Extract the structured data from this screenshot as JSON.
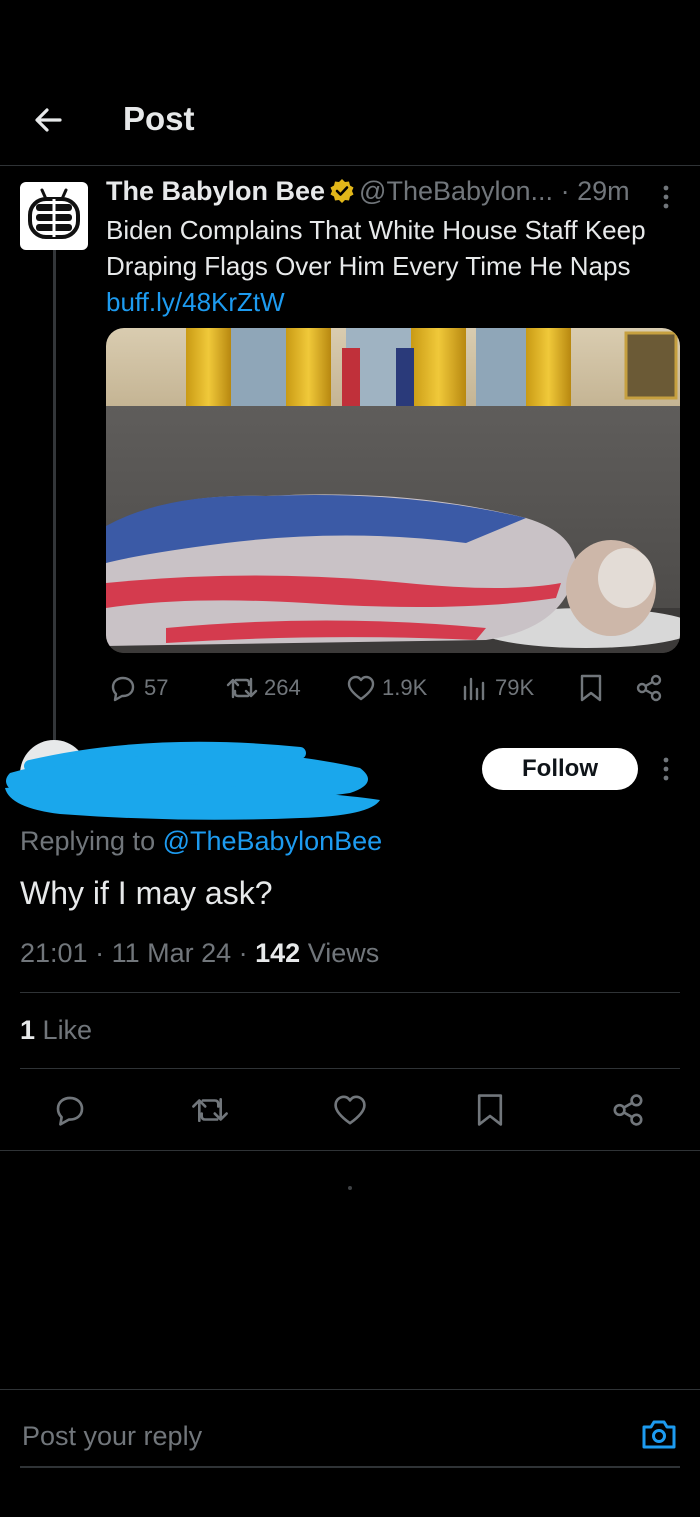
{
  "header": {
    "title": "Post"
  },
  "tweet": {
    "author_name": "The Babylon Bee",
    "handle": "@TheBabylon...",
    "time": "· 29m",
    "text": "Biden Complains That White House Staff Keep Draping Flags Over Him Every Time He Naps ",
    "link": "buff.ly/48KrZtW",
    "stats": {
      "replies": "57",
      "reposts": "264",
      "likes": "1.9K",
      "views": "79K"
    }
  },
  "reply": {
    "follow_label": "Follow",
    "replying_prefix": "Replying to ",
    "replying_to": "@TheBabylonBee",
    "text": "Why if I may ask?",
    "time": "21:01",
    "date": "11 Mar 24",
    "views_count": "142",
    "views_label": "Views",
    "likes_count": "1",
    "likes_label": "Like"
  },
  "composer": {
    "placeholder": "Post your reply"
  },
  "colors": {
    "accent": "#1d9bf0",
    "muted": "#71767b",
    "text": "#e7e9ea",
    "background": "#000000"
  },
  "icons": [
    "back-arrow-icon",
    "verified-badge-icon",
    "more-icon",
    "reply-icon",
    "repost-icon",
    "like-icon",
    "views-icon",
    "bookmark-icon",
    "share-icon",
    "camera-icon"
  ]
}
